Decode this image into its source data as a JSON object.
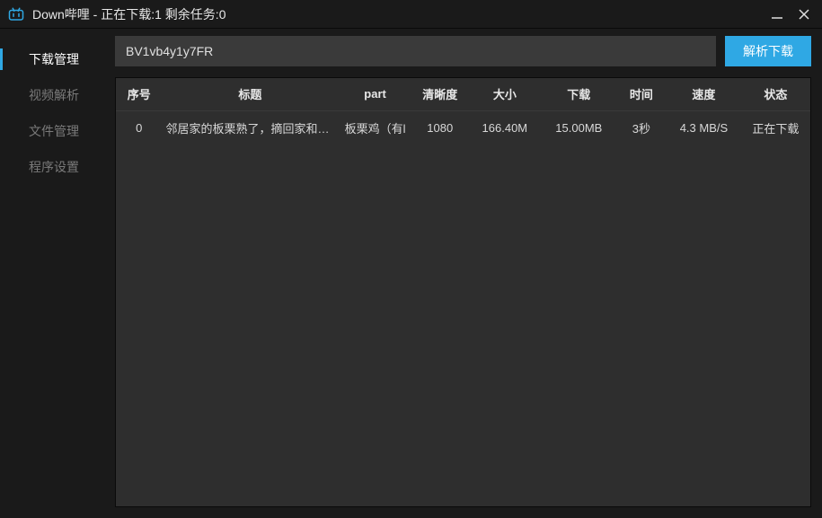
{
  "titlebar": {
    "text": "Down哔哩 - 正在下载:1  剩余任务:0"
  },
  "sidebar": {
    "items": [
      {
        "label": "下载管理",
        "active": true
      },
      {
        "label": "视频解析",
        "active": false
      },
      {
        "label": "文件管理",
        "active": false
      },
      {
        "label": "程序设置",
        "active": false
      }
    ]
  },
  "search": {
    "value": "BV1vb4y1y7FR",
    "button_label": "解析下载"
  },
  "table": {
    "headers": {
      "index": "序号",
      "title": "标题",
      "part": "part",
      "quality": "清晰度",
      "size": "大小",
      "downloaded": "下载",
      "time": "时间",
      "speed": "速度",
      "status": "状态"
    },
    "rows": [
      {
        "index": "0",
        "title": "邻居家的板栗熟了，摘回家和土鸡",
        "part": "板栗鸡（有l",
        "quality": "1080",
        "size": "166.40M",
        "downloaded": "15.00MB",
        "time": "3秒",
        "speed": "4.3 MB/S",
        "status": "正在下载"
      }
    ]
  },
  "colors": {
    "accent": "#2fa8e4",
    "bg_dark": "#1a1a1a",
    "bg_panel": "#2e2e2e",
    "bg_input": "#3a3a3a"
  }
}
